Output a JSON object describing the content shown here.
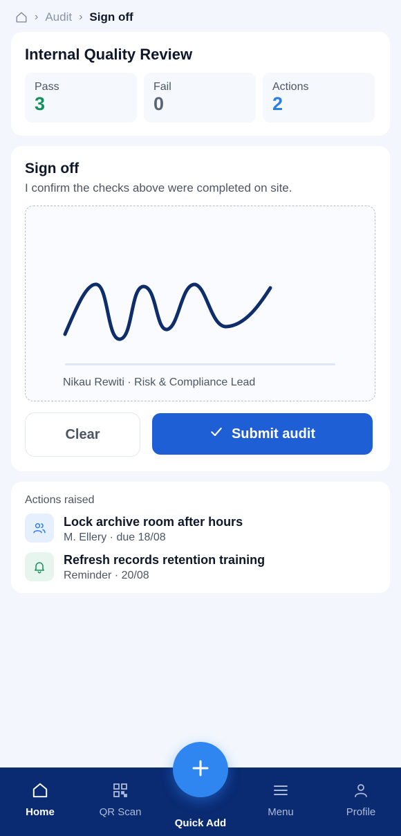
{
  "breadcrumb": {
    "home_icon": "home-icon",
    "items": [
      "Audit",
      "Sign off"
    ]
  },
  "review": {
    "title": "Internal Quality Review",
    "stats": [
      {
        "label": "Pass",
        "value": "3",
        "color": "#16905a"
      },
      {
        "label": "Fail",
        "value": "0",
        "color": "#5b6472"
      },
      {
        "label": "Actions",
        "value": "2",
        "color": "#2b7de9"
      }
    ]
  },
  "signoff": {
    "title": "Sign off",
    "subtitle": "I confirm the checks above were completed on site.",
    "signer_caption": "Nikau Rewiti · Risk & Compliance Lead",
    "signature_color": "#0f2d6b",
    "clear_label": "Clear",
    "submit_label": "Submit audit",
    "submit_color": "#1f5fd6"
  },
  "actions": {
    "heading": "Actions raised",
    "items": [
      {
        "icon": "users-icon",
        "title": "Lock archive room after hours",
        "subtitle": "M. Ellery · due 18/08"
      },
      {
        "icon": "bell-icon",
        "title": "Refresh records retention training",
        "subtitle": "Reminder · 20/08"
      }
    ]
  },
  "nav": {
    "items": [
      {
        "icon": "home-icon",
        "label": "Home",
        "active": true
      },
      {
        "icon": "qr-code-icon",
        "label": "QR Scan",
        "active": false
      },
      {
        "icon": "menu-icon",
        "label": "Menu",
        "active": false
      },
      {
        "icon": "user-icon",
        "label": "Profile",
        "active": false
      }
    ],
    "fab_label": "Quick Add",
    "fab_icon": "plus-icon",
    "background": "#0a2a72"
  }
}
